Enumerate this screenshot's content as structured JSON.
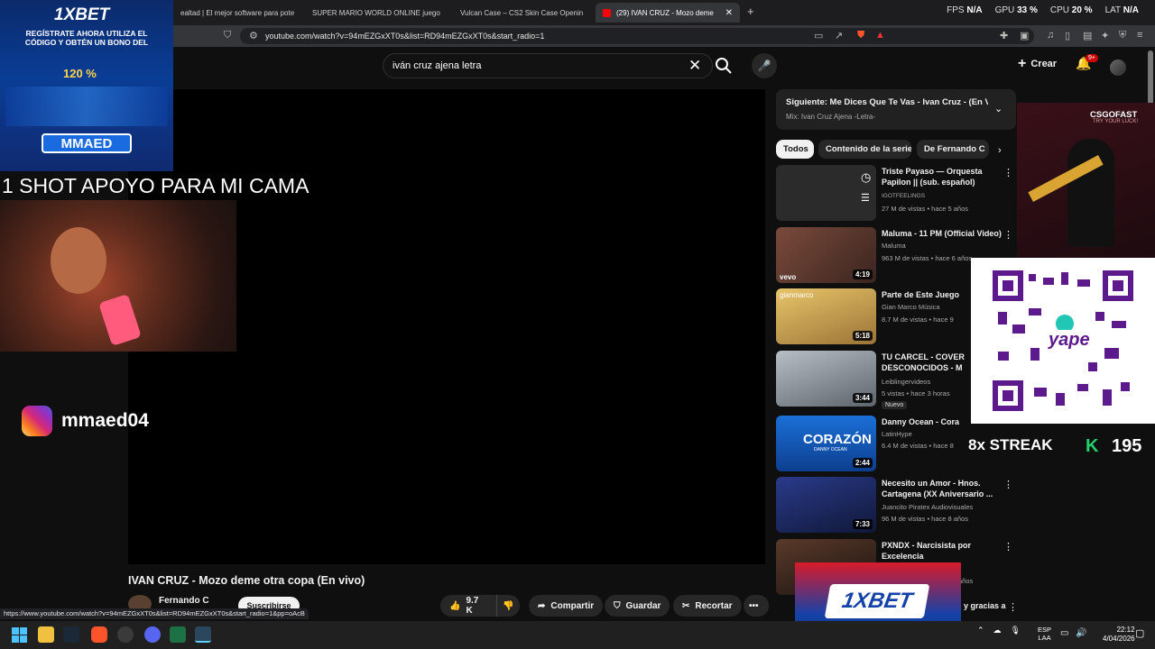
{
  "browser": {
    "tabs": [
      {
        "label": "ealtad | El mejor software para pote",
        "color": "#777"
      },
      {
        "label": "SUPER MARIO WORLD ONLINE juego",
        "color": "#e6b800"
      },
      {
        "label": "Vulcan Case – CS2 Skin Case Openin",
        "color": "#f0c000"
      },
      {
        "label": "(29) IVAN CRUZ - Mozo deme",
        "color": "#ff0000"
      }
    ],
    "new_tab": "+",
    "perf": {
      "fps_label": "FPS",
      "fps": "N/A",
      "gpu_label": "GPU",
      "gpu": "33 %",
      "cpu_label": "CPU",
      "cpu": "20 %",
      "lat_label": "LAT",
      "lat": "N/A"
    },
    "url": "youtube.com/watch?v=94mEZGxXT0s&list=RD94mEZGxXT0s&start_radio=1",
    "status_url": "https://www.youtube.com/watch?v=94mEZGxXT0s&list=RD94mEZGxXT0s&start_radio=1&pp=oAcB"
  },
  "youtube": {
    "search_value": "iván cruz ajena letra",
    "create_label": "Crear",
    "notif_badge": "9+",
    "video_title": "IVAN CRUZ - Mozo deme otra copa (En vivo)",
    "channel": "Fernando C",
    "subscribe_label": "Suscribirse",
    "like_count": "9.7 K",
    "share_label": "Compartir",
    "save_label": "Guardar",
    "clip_label": "Recortar",
    "more_label": "•••",
    "next": {
      "title": "Siguiente: Me Dices Que Te Vas - Ivan Cruz - (En Viv...",
      "subtitle": "Mix: Ivan Cruz Ajena -Letra-"
    },
    "chips": [
      "Todos",
      "Contenido de la serie",
      "De Fernando C"
    ],
    "recommendations": [
      {
        "title": "Triste Payaso — Orquesta Papilon || (sub. español)",
        "channel": "IGOTFEELINGS",
        "meta": "27 M de vistas • hace 5 años",
        "duration": "",
        "new": "",
        "thumb_color": "#2b2b2b"
      },
      {
        "title": "Maluma - 11 PM (Official Video)",
        "channel": "Maluma",
        "meta": "963 M de vistas • hace 6 años",
        "duration": "4:19",
        "new": "",
        "thumb_color": "#5a3a30"
      },
      {
        "title": "Parte de Este Juego",
        "channel": "Gian Marco Música",
        "meta": "8.7 M de vistas • hace 9",
        "duration": "5:18",
        "new": "",
        "thumb_color": "#c9a45a"
      },
      {
        "title": "TU CARCEL - COVER DESCONOCIDOS - M",
        "channel": "Leiblingervideos",
        "meta": "5 vistas • hace 3 horas",
        "duration": "3:44",
        "new": "Nuevo",
        "thumb_color": "#8a8f96"
      },
      {
        "title": "Danny Ocean - Cora",
        "channel": "LatinHype",
        "meta": "6.4 M de vistas • hace 8",
        "duration": "2:44",
        "new": "",
        "thumb_color": "#1f6ed0"
      },
      {
        "title": "Necesito un Amor - Hnos. Cartagena (XX Aniversario ...",
        "channel": "Juancito Piratex Audiovisuales",
        "meta": "96 M de vistas • hace 8 años",
        "duration": "7:33",
        "new": "",
        "thumb_color": "#1c2a66"
      },
      {
        "title": "PXNDX - Narcisista por Excelencia",
        "channel": "",
        "meta": "años",
        "duration": "",
        "new": "",
        "thumb_color": "#3a2a22"
      }
    ],
    "last_partial_title": "y gracias a",
    "thumb_texts": {
      "vevo": "vevo",
      "corazon": "CORAZÓN",
      "corazon_sub": "DANNY OCEAN",
      "gianmarco": "gianmarco"
    }
  },
  "overlays": {
    "ad_top_brand": "1XBET",
    "ad_top_text": "REGÍSTRATE AHORA UTILIZA EL CÓDIGO Y OBTÉN UN BONO DEL",
    "ad_top_pct": "120 %",
    "ad_top_code": "MMAED",
    "caption": "1 SHOT APOYO PARA MI CAMA",
    "instagram_handle": "mmaed04",
    "csgo_brand": "CSGOFAST",
    "csgo_tag": "TRY YOUR LUCK!",
    "qr_label": "yape",
    "streak_text": "8x STREAK",
    "streak_k": "K",
    "streak_num": "195",
    "ad_bottom_brand": "1XBET"
  },
  "taskbar": {
    "lang": "ESP",
    "lang2": "LAA",
    "time": "22:12",
    "date": "4/04/2026"
  }
}
